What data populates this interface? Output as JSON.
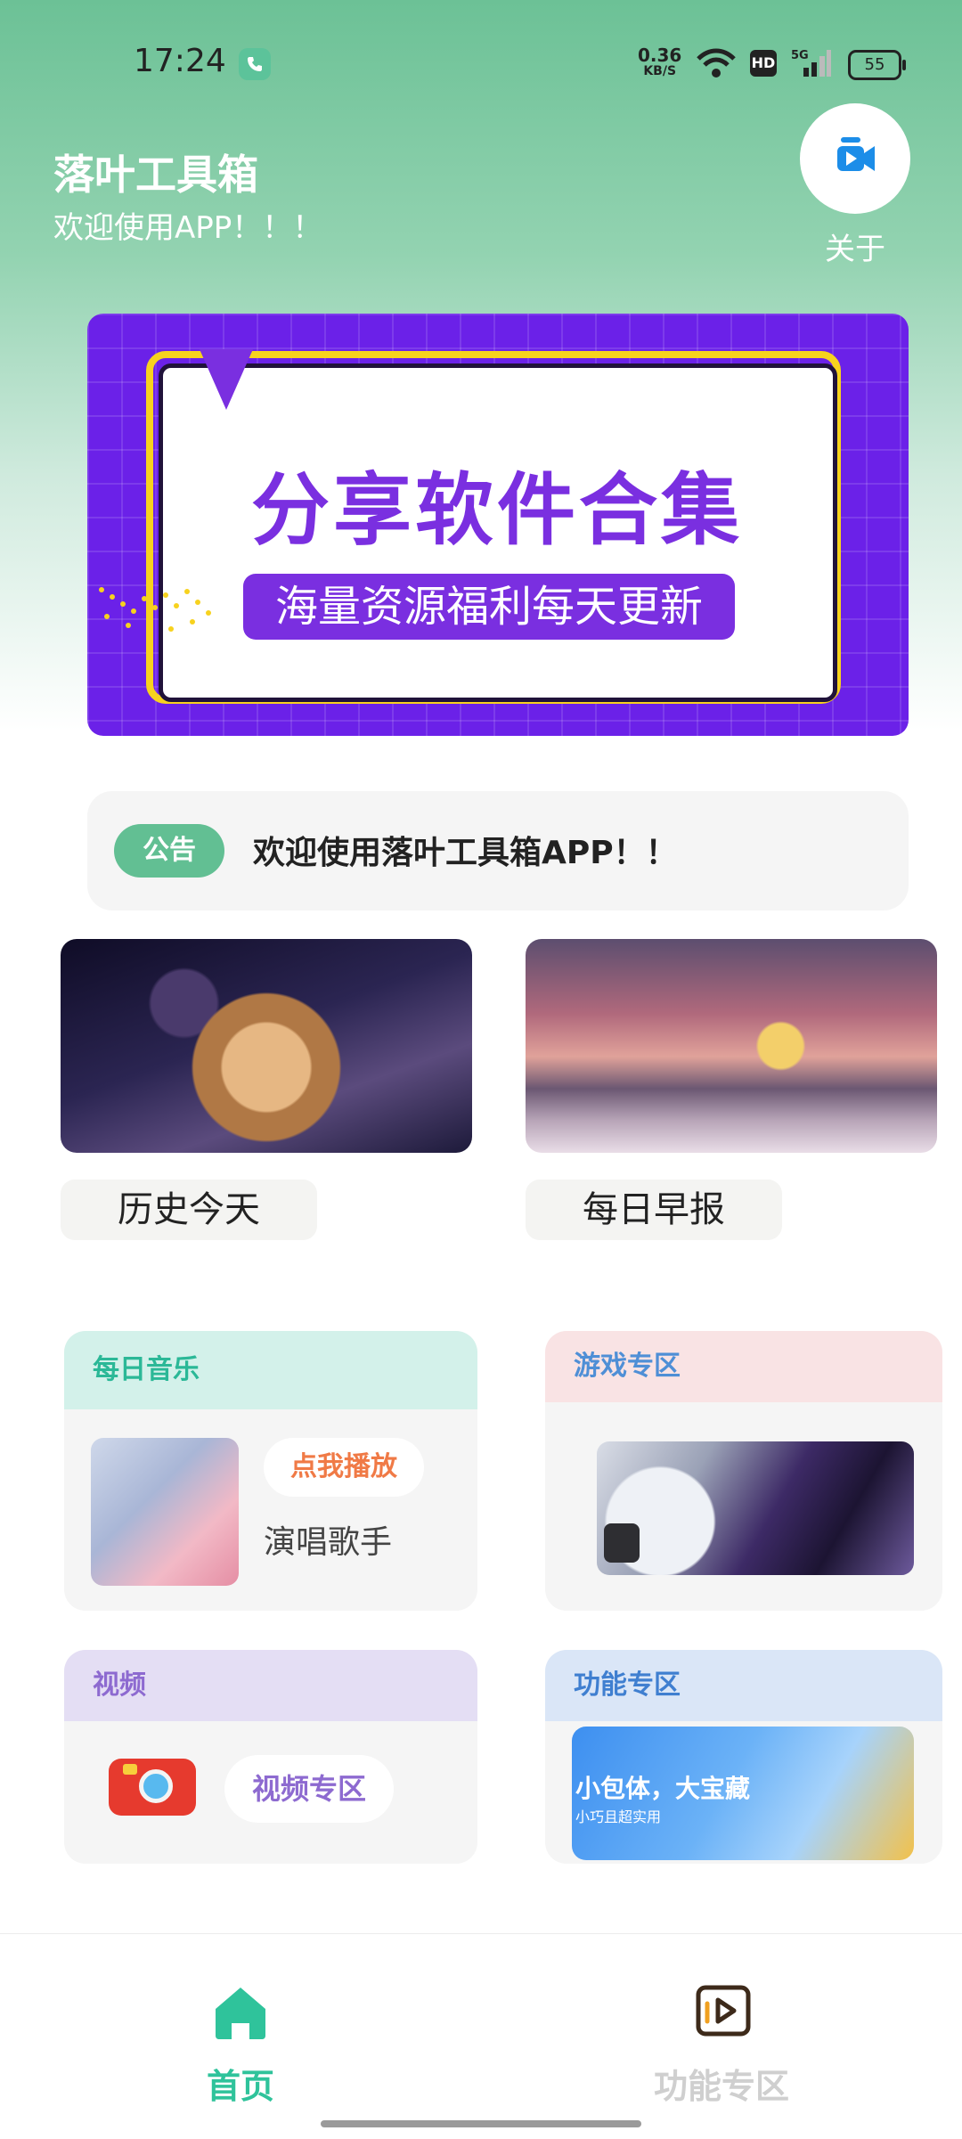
{
  "status_bar": {
    "time": "17:24",
    "net_speed_value": "0.36",
    "net_speed_unit": "KB/S",
    "hd_badge": "HD",
    "signal_label": "5G",
    "battery": "55"
  },
  "header": {
    "title": "落叶工具箱",
    "subtitle": "欢迎使用APP！！！",
    "about_label": "关于"
  },
  "banner": {
    "title": "分享软件合集",
    "pill_text": "海量资源福利每天更新"
  },
  "notice": {
    "badge": "公告",
    "text": "欢迎使用落叶工具箱APP！！"
  },
  "feature_cards": [
    {
      "label": "历史今天"
    },
    {
      "label": "每日早报"
    }
  ],
  "sections": {
    "music": {
      "title": "每日音乐",
      "play_button": "点我播放",
      "singer": "演唱歌手"
    },
    "game": {
      "title": "游戏专区"
    },
    "video": {
      "title": "视频",
      "button": "视频专区"
    },
    "func": {
      "title": "功能专区",
      "image_text": "小包体，大宝藏",
      "image_sub": "小巧且超实用"
    }
  },
  "bottom_nav": {
    "home_label": "首页",
    "func_label": "功能专区"
  },
  "colors": {
    "accent": "#2fc39b",
    "header_green": "#6cc196",
    "banner_purple": "#7a2fe0",
    "notice_badge": "#62bf93"
  }
}
